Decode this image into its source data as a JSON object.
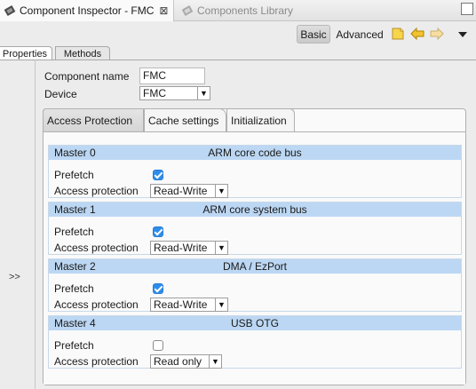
{
  "view_tabs": {
    "active_title": "Component Inspector - FMC",
    "close_glyph": "⊠",
    "inactive_title": "Components Library"
  },
  "toolbar": {
    "basic_label": "Basic",
    "advanced_label": "Advanced",
    "icons": [
      "new-note-icon",
      "back-arrow-icon",
      "forward-arrow-icon",
      "view-menu-chevron-icon"
    ]
  },
  "prop_tabs": {
    "properties": "Properties",
    "methods": "Methods"
  },
  "left_strip": {
    "expand_label": ">>"
  },
  "component": {
    "name_label": "Component name",
    "name_value": "FMC",
    "device_label": "Device",
    "device_value": "FMC"
  },
  "inner_tabs": [
    "Access Protection",
    "Cache settings",
    "Initialization"
  ],
  "groups": [
    {
      "name": "Master 0",
      "desc": "ARM core code bus",
      "prefetch_label": "Prefetch",
      "prefetch": true,
      "access_label": "Access protection",
      "access_value": "Read-Write"
    },
    {
      "name": "Master 1",
      "desc": "ARM core system bus",
      "prefetch_label": "Prefetch",
      "prefetch": true,
      "access_label": "Access protection",
      "access_value": "Read-Write"
    },
    {
      "name": "Master 2",
      "desc": "DMA / EzPort",
      "prefetch_label": "Prefetch",
      "prefetch": true,
      "access_label": "Access protection",
      "access_value": "Read-Write"
    },
    {
      "name": "Master 4",
      "desc": "USB OTG",
      "prefetch_label": "Prefetch",
      "prefetch": false,
      "access_label": "Access protection",
      "access_value": "Read only"
    }
  ],
  "colors": {
    "group_header": "#bcd7f3",
    "checkbox_on": "#2f8dea",
    "active_toolbar_btn": "#d3d3d3"
  }
}
